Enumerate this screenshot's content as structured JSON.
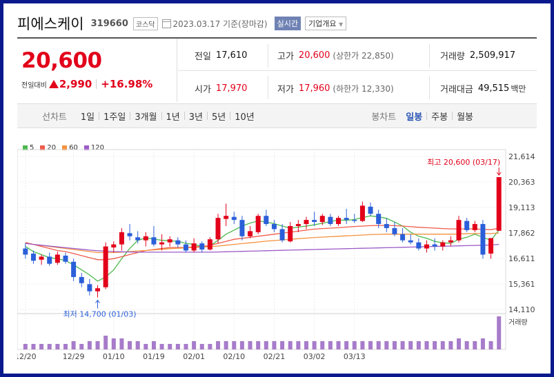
{
  "header": {
    "name": "피에스케이",
    "code": "319660",
    "market": "코스닥",
    "date": "2023.03.17",
    "basis": "기준(장마감)",
    "realtime_label": "실시간",
    "company_info_label": "기업개요"
  },
  "price": {
    "current": "20,600",
    "change_label": "전일대비",
    "change": "2,990",
    "change_pct": "+16.98%",
    "up_color": "#e2001a"
  },
  "stats": {
    "prev_label": "전일",
    "prev": "17,610",
    "high_label": "고가",
    "high": "20,600",
    "high_limit": "(상한가 22,850)",
    "volume_label": "거래량",
    "volume": "2,509,917",
    "open_label": "시가",
    "open": "17,970",
    "low_label": "저가",
    "low": "17,960",
    "low_limit": "(하한가 12,330)",
    "amount_label": "거래대금",
    "amount": "49,515",
    "amount_unit": "백만"
  },
  "tabs": {
    "line_label": "선차트",
    "line_periods": [
      "1일",
      "1주일",
      "3개월",
      "1년",
      "3년",
      "5년",
      "10년"
    ],
    "candle_label": "봉차트",
    "candle_periods": [
      "일봉",
      "주봉",
      "월봉"
    ],
    "candle_selected": 0
  },
  "legend": [
    {
      "label": "5",
      "color": "#4cb84c"
    },
    {
      "label": "20",
      "color": "#f05a4a"
    },
    {
      "label": "60",
      "color": "#f5923e"
    },
    {
      "label": "120",
      "color": "#9b59c7"
    }
  ],
  "annotations": {
    "high_label": "최고 20,600 (03/17)",
    "low_label": "최저 14,700 (01/03)",
    "volume_label": "거래량"
  },
  "chart_data": {
    "type": "candlestick",
    "ylim": [
      14110,
      21614
    ],
    "yticks": [
      "21,614",
      "20,363",
      "19,113",
      "17,862",
      "16,611",
      "15,361",
      "14,110"
    ],
    "xticks": [
      "12/20",
      "12/29",
      "01/10",
      "01/19",
      "02/01",
      "02/10",
      "02/21",
      "03/02",
      "03/13"
    ],
    "xtick_index": [
      0,
      6,
      11,
      16,
      21,
      26,
      31,
      36,
      41
    ],
    "candles": [
      [
        17100,
        17350,
        16600,
        16800
      ],
      [
        16850,
        17000,
        16350,
        16500
      ],
      [
        16550,
        16800,
        16300,
        16700
      ],
      [
        16700,
        16900,
        16250,
        16350
      ],
      [
        16400,
        16950,
        16300,
        16800
      ],
      [
        16750,
        16900,
        16350,
        16450
      ],
      [
        16450,
        16600,
        15500,
        15700
      ],
      [
        15700,
        15900,
        15200,
        15400
      ],
      [
        15350,
        15600,
        14800,
        15000
      ],
      [
        15000,
        15300,
        14700,
        15150
      ],
      [
        15200,
        17400,
        15100,
        17200
      ],
      [
        17150,
        17450,
        16900,
        17300
      ],
      [
        17300,
        18100,
        17000,
        17900
      ],
      [
        17850,
        18300,
        17500,
        17700
      ],
      [
        17650,
        17950,
        17350,
        17500
      ],
      [
        17500,
        17900,
        17200,
        17700
      ],
      [
        17650,
        18200,
        17200,
        17300
      ],
      [
        17300,
        17800,
        17000,
        17400
      ],
      [
        17400,
        17700,
        17200,
        17550
      ],
      [
        17500,
        17650,
        17150,
        17300
      ],
      [
        17300,
        17500,
        16900,
        17000
      ],
      [
        17000,
        17600,
        16900,
        17350
      ],
      [
        17350,
        17450,
        16900,
        17050
      ],
      [
        17050,
        17650,
        17000,
        17550
      ],
      [
        17550,
        18800,
        17350,
        18600
      ],
      [
        18550,
        19300,
        18200,
        18700
      ],
      [
        18650,
        18900,
        18300,
        18500
      ],
      [
        18500,
        18700,
        17500,
        17700
      ],
      [
        17700,
        18200,
        17600,
        17950
      ],
      [
        17900,
        18800,
        17800,
        18700
      ],
      [
        18700,
        19000,
        18200,
        18300
      ],
      [
        18300,
        18500,
        17900,
        18050
      ],
      [
        18050,
        18300,
        17400,
        17500
      ],
      [
        17450,
        18400,
        17400,
        18200
      ],
      [
        18200,
        18500,
        17900,
        18300
      ],
      [
        18300,
        18650,
        18050,
        18500
      ],
      [
        18500,
        18900,
        18200,
        18400
      ],
      [
        18400,
        18800,
        18250,
        18700
      ],
      [
        18650,
        18800,
        18200,
        18300
      ],
      [
        18300,
        18700,
        18200,
        18600
      ],
      [
        18600,
        19050,
        18300,
        18500
      ],
      [
        18500,
        18800,
        18350,
        18450
      ],
      [
        18450,
        19400,
        18400,
        19200
      ],
      [
        19150,
        19350,
        18700,
        18800
      ],
      [
        18800,
        19000,
        18100,
        18300
      ],
      [
        18300,
        18600,
        17900,
        18100
      ],
      [
        18100,
        18400,
        17700,
        17800
      ],
      [
        17800,
        18100,
        17400,
        17500
      ],
      [
        17500,
        17800,
        17300,
        17400
      ],
      [
        17400,
        17600,
        17000,
        17100
      ],
      [
        17100,
        17500,
        16900,
        17300
      ],
      [
        17300,
        17600,
        17000,
        17200
      ],
      [
        17200,
        17500,
        17000,
        17400
      ],
      [
        17400,
        17700,
        17200,
        17500
      ],
      [
        17500,
        18700,
        17400,
        18500
      ],
      [
        18450,
        18600,
        17900,
        18000
      ],
      [
        18000,
        18450,
        17900,
        18300
      ],
      [
        18300,
        18500,
        16600,
        16800
      ],
      [
        16850,
        17600,
        16600,
        17610
      ],
      [
        17970,
        20600,
        17960,
        20600
      ]
    ],
    "volumes": [
      2,
      2,
      2,
      2,
      2,
      2,
      3,
      2,
      3,
      3,
      5,
      4,
      4,
      3,
      3,
      2,
      3,
      2,
      2,
      2,
      2,
      3,
      2,
      2,
      3,
      3,
      3,
      3,
      3,
      3,
      3,
      3,
      3,
      3,
      3,
      3,
      3,
      3,
      3,
      3,
      3,
      3,
      3,
      3,
      3,
      3,
      3,
      3,
      3,
      3,
      3,
      3,
      3,
      3,
      4,
      3,
      3,
      4,
      3,
      12
    ],
    "ma5": [
      17200,
      16950,
      16800,
      16650,
      16600,
      16500,
      16300,
      16050,
      15800,
      15500,
      15700,
      16050,
      16600,
      17100,
      17500,
      17620,
      17560,
      17500,
      17480,
      17450,
      17350,
      17300,
      17200,
      17230,
      17500,
      17800,
      18000,
      18200,
      18350,
      18450,
      18400,
      18320,
      18200,
      18100,
      18150,
      18200,
      18260,
      18340,
      18420,
      18500,
      18480,
      18520,
      18620,
      18700,
      18650,
      18580,
      18400,
      18200,
      17900,
      17700,
      17600,
      17450,
      17380,
      17350,
      17550,
      17650,
      17800,
      17650,
      17500,
      18000
    ],
    "ma20": [
      17400,
      17300,
      17200,
      17100,
      17000,
      16950,
      16850,
      16750,
      16650,
      16550,
      16550,
      16600,
      16700,
      16800,
      16900,
      17000,
      17050,
      17100,
      17150,
      17150,
      17150,
      17180,
      17200,
      17250,
      17350,
      17450,
      17550,
      17600,
      17650,
      17700,
      17750,
      17800,
      17850,
      17900,
      17950,
      18000,
      18050,
      18080,
      18100,
      18120,
      18150,
      18180,
      18200,
      18220,
      18230,
      18230,
      18220,
      18200,
      18170,
      18140,
      18120,
      18100,
      18080,
      18060,
      18060,
      18060,
      18060,
      18040,
      18020,
      18100
    ],
    "ma60": [
      17350,
      17300,
      17250,
      17200,
      17150,
      17100,
      17050,
      17000,
      16950,
      16900,
      16900,
      16900,
      16920,
      16950,
      16980,
      17000,
      17030,
      17060,
      17090,
      17110,
      17130,
      17150,
      17170,
      17190,
      17220,
      17260,
      17300,
      17340,
      17380,
      17420,
      17460,
      17490,
      17520,
      17550,
      17580,
      17610,
      17640,
      17660,
      17680,
      17700,
      17720,
      17740,
      17760,
      17780,
      17790,
      17800,
      17800,
      17800,
      17800,
      17800,
      17800,
      17800,
      17800,
      17800,
      17810,
      17820,
      17830,
      17830,
      17830,
      17860
    ],
    "ma120": [
      17350,
      17300,
      17260,
      17220,
      17180,
      17140,
      17100,
      17060,
      17020,
      16990,
      16970,
      16950,
      16940,
      16930,
      16920,
      16920,
      16920,
      16920,
      16920,
      16920,
      16920,
      16920,
      16920,
      16920,
      16930,
      16940,
      16950,
      16960,
      16970,
      16980,
      16990,
      17000,
      17010,
      17020,
      17030,
      17040,
      17050,
      17060,
      17070,
      17080,
      17090,
      17100,
      17110,
      17120,
      17130,
      17140,
      17150,
      17160,
      17170,
      17180,
      17190,
      17200,
      17210,
      17220,
      17230,
      17240,
      17250,
      17260,
      17270,
      17300
    ],
    "up_color": "#e2001a",
    "down_color": "#2b5fd9"
  }
}
